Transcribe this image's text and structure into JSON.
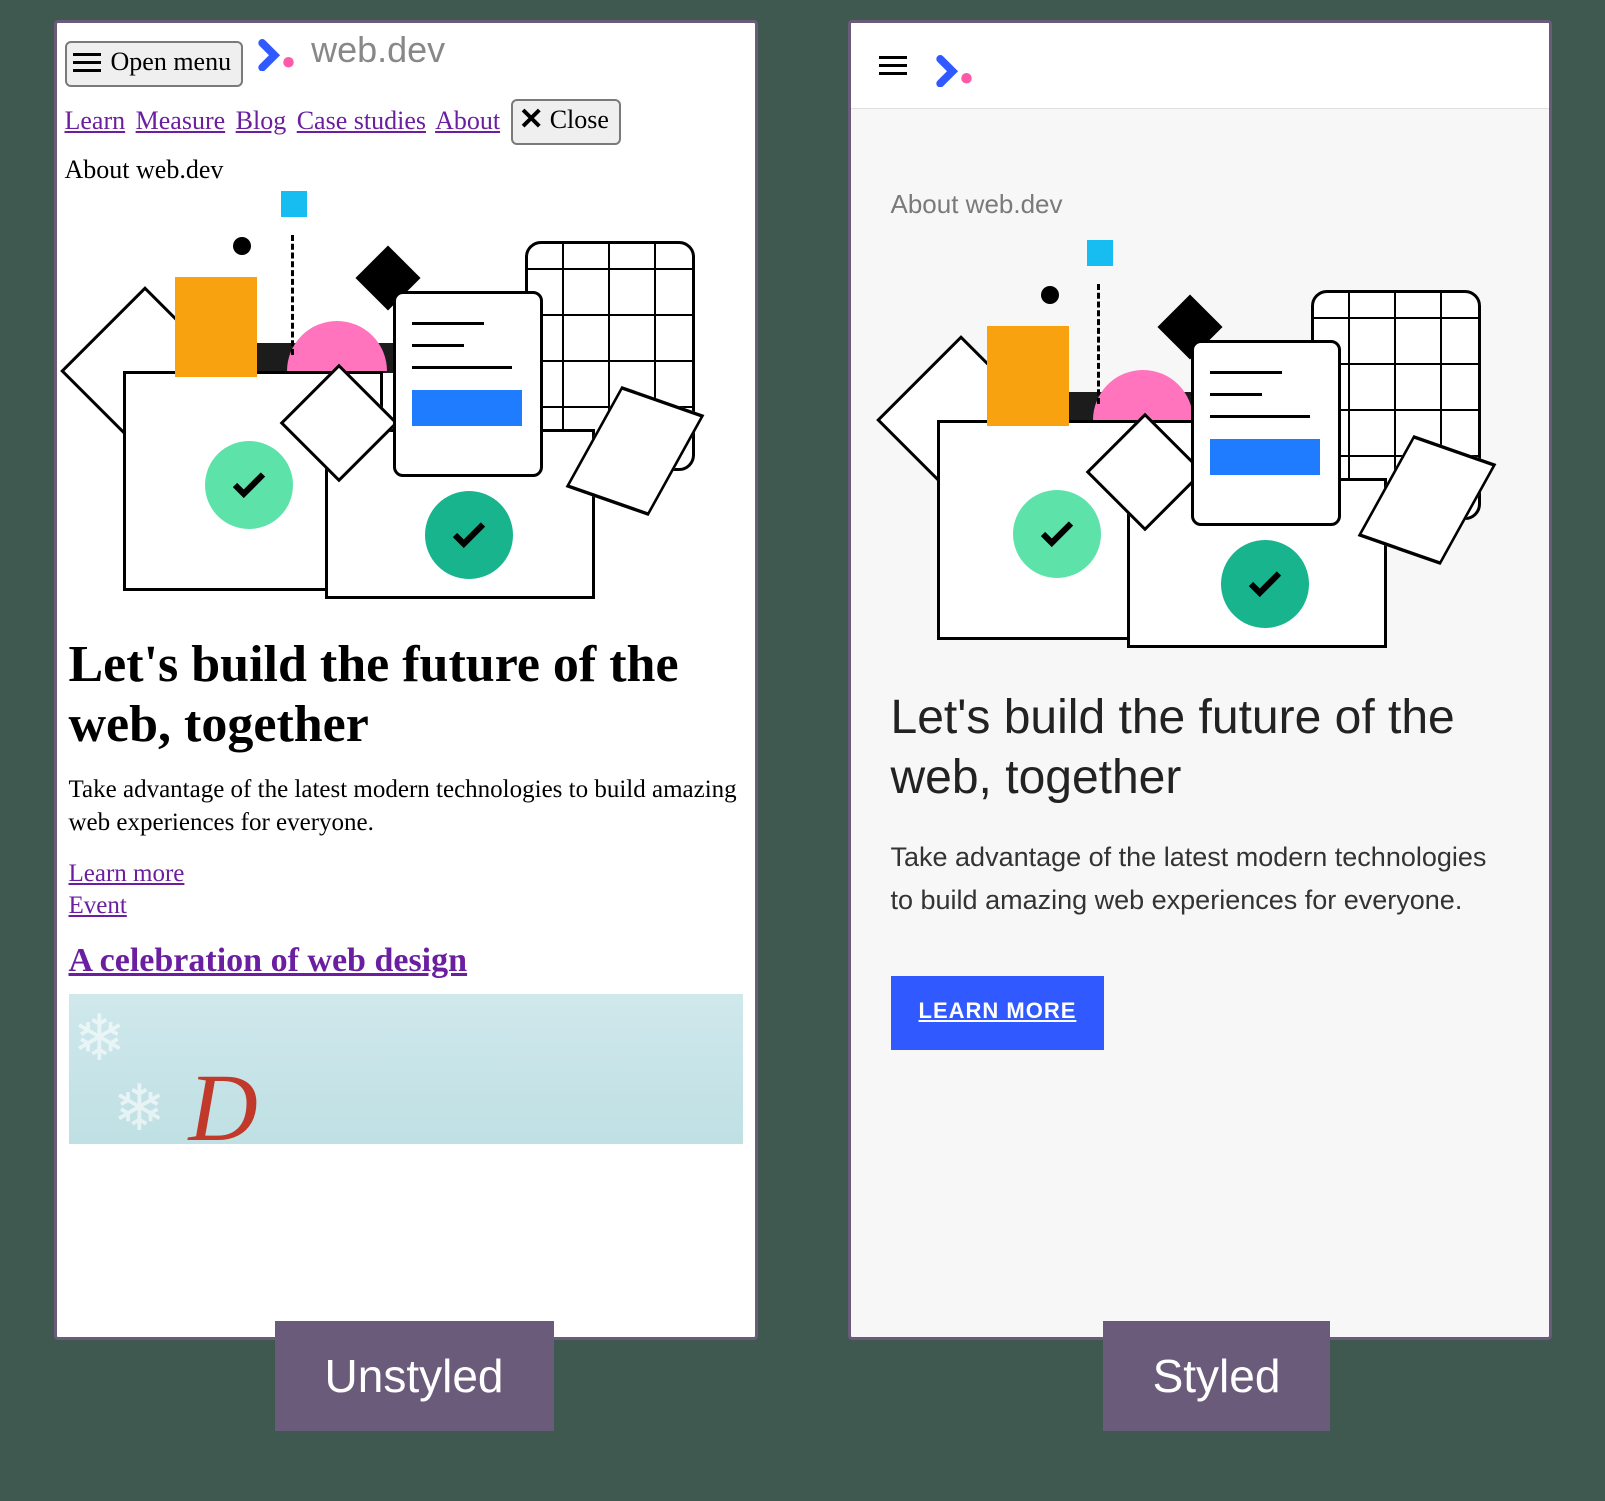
{
  "logo_text": "web.dev",
  "open_menu_label": "Open menu",
  "close_label": "Close",
  "nav": {
    "learn": "Learn",
    "measure": "Measure",
    "blog": "Blog",
    "case_studies": "Case studies",
    "about": "About"
  },
  "eyebrow": "About web.dev",
  "headline": "Let's build the future of the web, together",
  "subhead": "Take advantage of the latest modern technologies to build amazing web experiences for everyone.",
  "learn_more_link": "Learn more",
  "event_link": "Event",
  "article_heading": "A celebration of web design",
  "cta_button": "LEARN MORE",
  "labels": {
    "left": "Unstyled",
    "right": "Styled"
  }
}
